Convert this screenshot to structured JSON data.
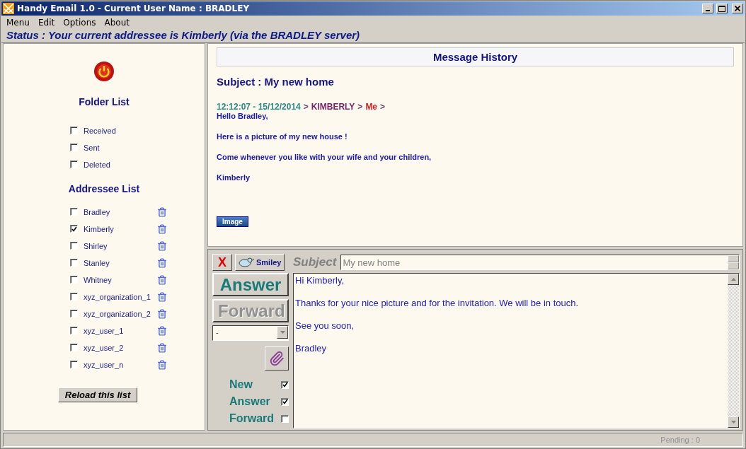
{
  "window": {
    "title": "Handy Email 1.0 - Current User Name : BRADLEY"
  },
  "menu": [
    {
      "label": "Menu"
    },
    {
      "label": "Edit"
    },
    {
      "label": "Options"
    },
    {
      "label": "About"
    }
  ],
  "status": "Status : Your current addressee is Kimberly (via the BRADLEY server)",
  "sidebar": {
    "folder_title": "Folder List",
    "folders": [
      {
        "label": "Received",
        "checked": false
      },
      {
        "label": "Sent",
        "checked": false
      },
      {
        "label": "Deleted",
        "checked": false
      }
    ],
    "addressee_title": "Addressee List",
    "addressees": [
      {
        "label": "Bradley",
        "checked": false
      },
      {
        "label": "Kimberly",
        "checked": true
      },
      {
        "label": "Shirley",
        "checked": false
      },
      {
        "label": "Stanley",
        "checked": false
      },
      {
        "label": "Whitney",
        "checked": false
      },
      {
        "label": "xyz_organization_1",
        "checked": false
      },
      {
        "label": "xyz_organization_2",
        "checked": false
      },
      {
        "label": "xyz_user_1",
        "checked": false
      },
      {
        "label": "xyz_user_2",
        "checked": false
      },
      {
        "label": "xyz_user_n",
        "checked": false
      }
    ],
    "reload_button": "Reload this list"
  },
  "history": {
    "title": "Message History",
    "subject": "Subject : My new home",
    "header": [
      {
        "text": "12:12:07 - 15/12/2014",
        "color": "#2a8a88"
      },
      {
        "text": ">",
        "color": "#6a3a6a"
      },
      {
        "text": "KIMBERLY",
        "color": "#7a2468"
      },
      {
        "text": ">",
        "color": "#6a3a6a"
      },
      {
        "text": "Me",
        "color": "#d42020"
      },
      {
        "text": ">",
        "color": "#6a3a6a"
      }
    ],
    "lines": [
      "Hello Bradley,",
      "Here is a picture of my new house !",
      "Come whenever you like with your wife and your children,",
      "Kimberly"
    ],
    "attachment_button": "Image"
  },
  "compose": {
    "close_button": "X",
    "smiley_button": "Smiley",
    "subject_label": "Subject",
    "subject_value": "My new home",
    "answer_button": {
      "label": "Answer",
      "disabled": false
    },
    "forward_button": {
      "label": "Forward",
      "disabled": true
    },
    "dropdown_value": "-",
    "options": [
      {
        "label": "New",
        "checked": true
      },
      {
        "label": "Answer",
        "checked": true
      },
      {
        "label": "Forward",
        "checked": false
      }
    ],
    "body_lines": [
      "Hi Kimberly,",
      "Thanks for your nice picture and for the invitation. We will be in touch.",
      "See you soon,",
      "Bradley"
    ]
  },
  "status_bar": {
    "pending": "Pending : 0"
  }
}
